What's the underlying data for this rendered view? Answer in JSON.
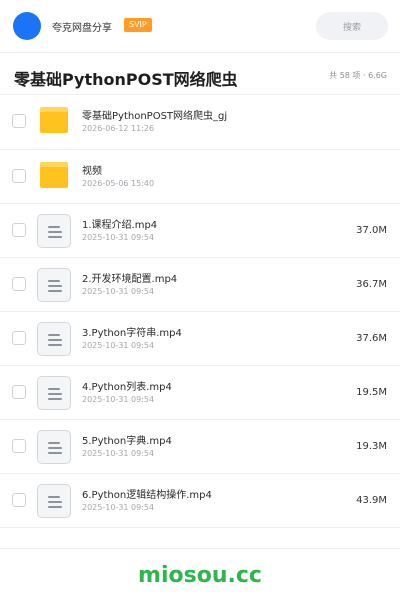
{
  "header": {
    "share_name": "夸克网盘分享",
    "badge": "SVIP",
    "search_label": "搜索"
  },
  "folder": {
    "title": "零基础PythonPOST网络爬虫",
    "summary": "共 58 项 · 6.6G"
  },
  "files": [
    {
      "type": "folder",
      "name": "零基础PythonPOST网络爬虫_gj",
      "date": "2026-06-12 11:26",
      "size": ""
    },
    {
      "type": "folder",
      "name": "视频",
      "date": "2026-05-06 15:40",
      "size": ""
    },
    {
      "type": "file",
      "name": "1.课程介绍.mp4",
      "date": "2025-10-31 09:54",
      "size": "37.0M"
    },
    {
      "type": "file",
      "name": "2.开发环境配置.mp4",
      "date": "2025-10-31 09:54",
      "size": "36.7M"
    },
    {
      "type": "file",
      "name": "3.Python字符串.mp4",
      "date": "2025-10-31 09:54",
      "size": "37.6M"
    },
    {
      "type": "file",
      "name": "4.Python列表.mp4",
      "date": "2025-10-31 09:54",
      "size": "19.5M"
    },
    {
      "type": "file",
      "name": "5.Python字典.mp4",
      "date": "2025-10-31 09:54",
      "size": "19.3M"
    },
    {
      "type": "file",
      "name": "6.Python逻辑结构操作.mp4",
      "date": "2025-10-31 09:54",
      "size": "43.9M"
    }
  ],
  "watermark": "miosou.cc",
  "colors": {
    "avatar": "#1b73f5",
    "badge": "#ff9c24",
    "folder": "#ffc21e",
    "watermark": "#2db64c"
  }
}
